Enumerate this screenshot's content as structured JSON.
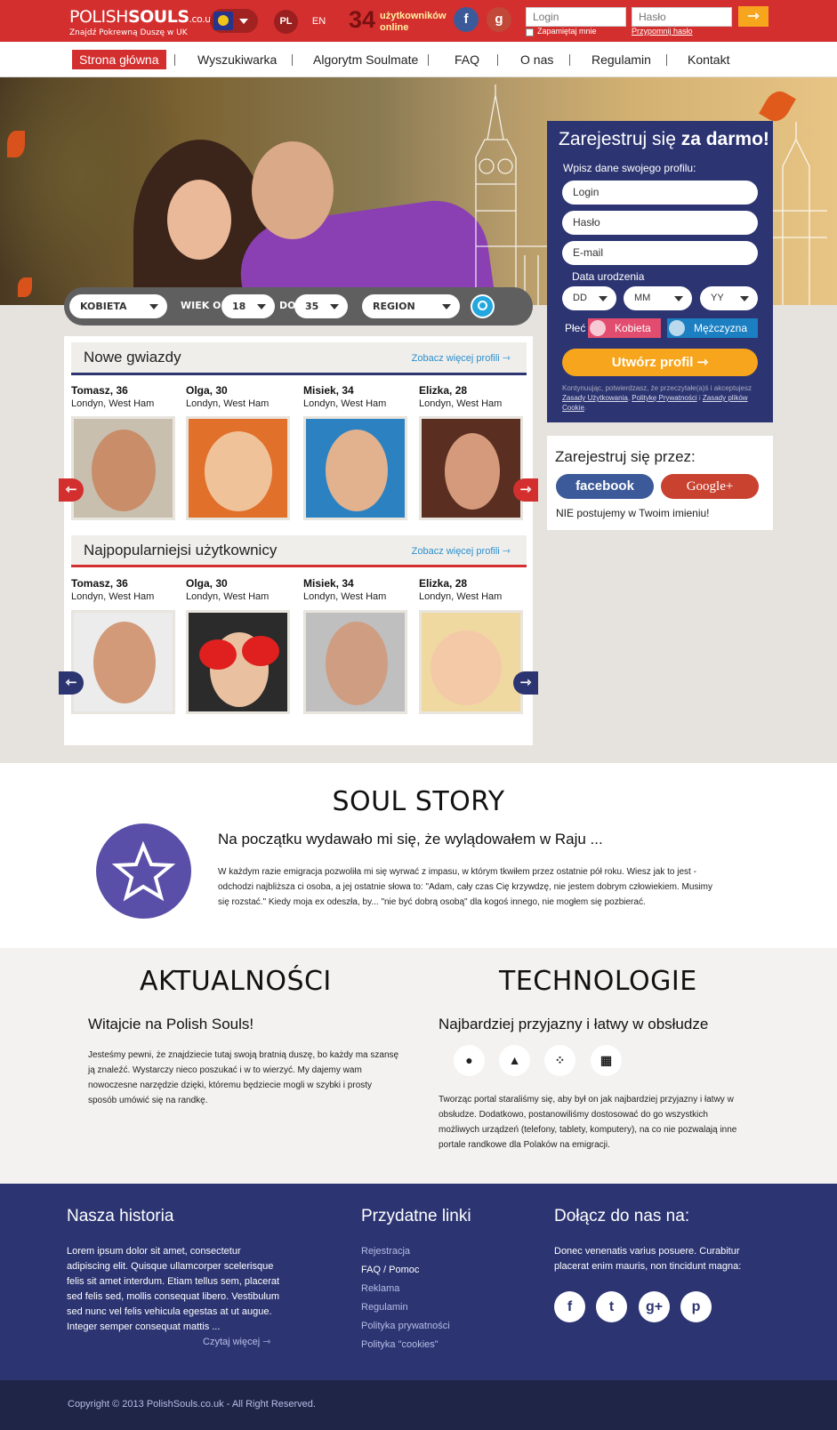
{
  "header": {
    "logo_part1": "POLISH",
    "logo_part2": "SOULS",
    "logo_domain": ".co.uk",
    "tagline": "Znajdź Pokrewną Duszę w UK",
    "lang_pl": "PL",
    "lang_en": "EN",
    "online_count": "34",
    "online_label1": "użytkowników",
    "online_label2": "online",
    "fb_icon": "f",
    "gplus_icon": "g",
    "login_placeholder": "Login",
    "password_placeholder": "Hasło",
    "remember": "Zapamiętaj mnie",
    "forgot": "Przypomnij hasło",
    "go_icon": "arrow-right-icon"
  },
  "nav": {
    "items": [
      "Strona główna",
      "Wyszukiwarka",
      "Algorytm Soulmate",
      "FAQ",
      "O nas",
      "Regulamin",
      "Kontakt"
    ]
  },
  "search": {
    "gender": "KOBIETA",
    "age_label": "WIEK OD",
    "age_from": "18",
    "age_to_label": "DO",
    "age_to": "35",
    "region": "REGION"
  },
  "register": {
    "title_plain": "Zarejestruj się ",
    "title_bold": "za darmo!",
    "subtitle": "Wpisz dane swojego profilu:",
    "login": "Login",
    "password": "Hasło",
    "email": "E-mail",
    "dob_label": "Data urodzenia",
    "dd": "DD",
    "mm": "MM",
    "yy": "YY",
    "gender_label": "Płeć",
    "female": "Kobieta",
    "male": "Mężczyzna",
    "create": "Utwórz profil",
    "terms_1": "Kontynuując, potwierdzasz, że przeczytałe(a)ś i akceptujesz ",
    "terms_link1": "Zasady Użytkowania",
    "terms_2": ", ",
    "terms_link2": "Politykę Prywatności",
    "terms_3": " i ",
    "terms_link3": "Zasady plików Cookie",
    "terms_4": "."
  },
  "social_register": {
    "title": "Zarejestruj się przez:",
    "facebook": "facebook",
    "google": "Google+",
    "note": "NIE postujemy w Twoim imieniu!"
  },
  "new_stars": {
    "title": "Nowe gwiazdy",
    "more": "Zobacz więcej profili",
    "profiles": [
      {
        "name": "Tomasz, 36",
        "loc": "Londyn, West Ham"
      },
      {
        "name": "Olga, 30",
        "loc": "Londyn, West Ham"
      },
      {
        "name": "Misiek, 34",
        "loc": "Londyn, West Ham"
      },
      {
        "name": "Elizka, 28",
        "loc": "Londyn, West Ham"
      }
    ]
  },
  "popular": {
    "title": "Najpopularniejsi użytkownicy",
    "more": "Zobacz więcej profili",
    "profiles": [
      {
        "name": "Tomasz, 36",
        "loc": "Londyn, West Ham"
      },
      {
        "name": "Olga, 30",
        "loc": "Londyn, West Ham"
      },
      {
        "name": "Misiek, 34",
        "loc": "Londyn, West Ham"
      },
      {
        "name": "Elizka, 28",
        "loc": "Londyn, West Ham"
      }
    ]
  },
  "story": {
    "heading": "SOUL STORY",
    "title": "Na początku wydawało mi się, że wylądowałem w Raju ...",
    "text": "W każdym razie emigracja pozwoliła mi się wyrwać z impasu, w którym tkwiłem przez ostatnie pół roku. Wiesz jak to jest - odchodzi najbliższa ci osoba, a jej ostatnie słowa to: \"Adam, cały czas Cię krzywdzę, nie jestem dobrym człowiekiem. Musimy się rozstać.\" Kiedy moja ex odeszła, by... \"nie być dobrą osobą\" dla kogoś innego, nie mogłem się pozbierać."
  },
  "news": {
    "heading": "AKTUALNOŚCI",
    "title": "Witajcie na Polish Souls!",
    "text": "Jesteśmy pewni, że znajdziecie tutaj swoją bratnią duszę, bo każdy ma szansę ją znaleźć. Wystarczy nieco poszukać i w to wierzyć. My dajemy wam nowoczesne narzędzie dzięki, któremu będziecie mogli w szybki i prosty sposób umówić się na randkę."
  },
  "tech": {
    "heading": "TECHNOLOGIE",
    "title": "Najbardziej przyjazny i łatwy w obsłudze",
    "text": "Tworząc portal staraliśmy się, aby był on jak najbardziej przyjazny i łatwy w obsłudze. Dodatkowo, postanowiliśmy dostosować do go wszystkich możliwych urządzeń (telefony, tablety, komputery), na co nie pozwalają inne portale randkowe dla Polaków na emigracji.",
    "icons": [
      "apple-icon",
      "android-icon",
      "blackberry-icon",
      "windows-icon"
    ]
  },
  "footer": {
    "history_title": "Nasza historia",
    "history_text": "Lorem ipsum dolor sit amet, consectetur adipiscing elit. Quisque ullamcorper scelerisque felis sit amet interdum. Etiam tellus sem, placerat sed felis sed, mollis consequat libero. Vestibulum sed nunc vel felis vehicula egestas at ut augue. Integer semper consequat mattis ...",
    "read_more": "Czytaj więcej",
    "links_title": "Przydatne linki",
    "links": [
      "Rejestracja",
      "FAQ / Pomoc",
      "Reklama",
      "Regulamin",
      "Polityka prywatności",
      "Polityka \"cookies\""
    ],
    "join_title": "Dołącz do nas na:",
    "join_text": "Donec venenatis varius posuere. Curabitur placerat enim mauris, non tincidunt magna:",
    "social": [
      "facebook-icon",
      "twitter-icon",
      "google-plus-icon",
      "pinterest-icon"
    ]
  },
  "copyright": "Copyright © 2013 PolishSouls.co.uk - All Right Reserved."
}
